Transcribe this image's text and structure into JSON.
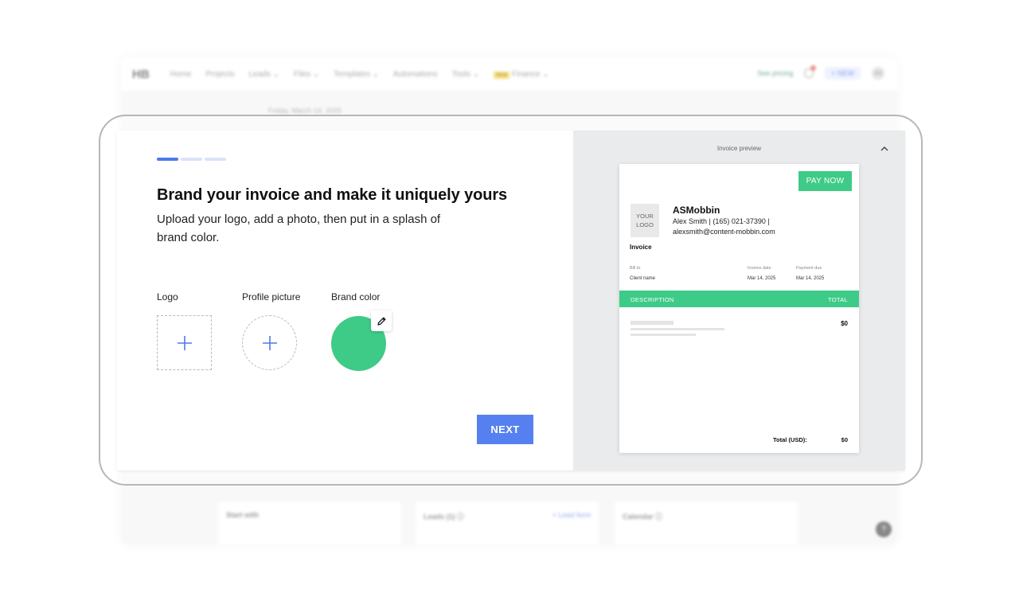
{
  "background_app": {
    "logo": "HB",
    "nav": [
      "Home",
      "Projects",
      "Leads ⌄",
      "Files ⌄",
      "Templates ⌄",
      "Automations",
      "Tools ⌄"
    ],
    "new_badge": "New",
    "finance": "Finance ⌄",
    "see_pricing": "See pricing",
    "new_button": "+ NEW",
    "avatar": "AS",
    "date": "Friday, March 14, 2025",
    "cards": [
      "Start with",
      "Leads (1) ⓘ",
      "Calendar ⓘ"
    ],
    "lead_form": "+ Lead form",
    "help": "?"
  },
  "onboarding": {
    "progress_steps": 3,
    "active_step": 1,
    "title": "Brand your invoice and make it uniquely yours",
    "subtitle": "Upload your logo, add a photo, then put in a splash of brand color.",
    "logo_label": "Logo",
    "profile_label": "Profile picture",
    "brand_color_label": "Brand color",
    "brand_color": "#3ecb87",
    "next_label": "NEXT"
  },
  "preview": {
    "label": "Invoice preview",
    "pay_now": "PAY NOW",
    "logo_placeholder": "YOUR LOGO",
    "company": "ASMobbin",
    "contact_line1": "Alex Smith | (165) 021-37390 |",
    "contact_line2": "alexsmith@content-mobbin.com",
    "doc_label": "Invoice",
    "bill_to_label": "Bill to",
    "bill_to_value": "Client name",
    "invoice_date_label": "Invoice date",
    "invoice_date_value": "Mar 14, 2025",
    "payment_due_label": "Payment due",
    "payment_due_value": "Mar 14, 2025",
    "description_header": "DESCRIPTION",
    "total_header": "TOTAL",
    "line_amount": "$0",
    "total_label": "Total (USD):",
    "total_amount": "$0"
  }
}
